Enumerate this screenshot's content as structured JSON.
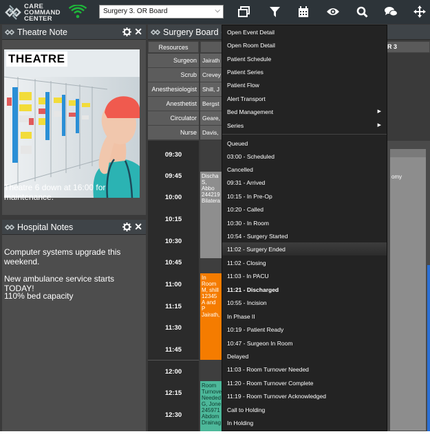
{
  "app": {
    "logo_lines": [
      "CARE",
      "COMMAND",
      "CENTER"
    ],
    "board_select": "Surgery 3. OR Board"
  },
  "toolbar_icons": [
    "window-icon",
    "filter-icon",
    "calendar-icon",
    "eye-icon",
    "search-icon",
    "chat-icon",
    "move-icon"
  ],
  "theatre_panel": {
    "title": "Theatre Note",
    "image_label": "THEATRE",
    "note": "Theatre 6 down at 16:00 for maintenance."
  },
  "hospital_panel": {
    "title": "Hospital Notes",
    "notes": [
      "Computer systems upgrade this weekend.",
      "New ambulance service starts TODAY!",
      "110% bed capacity"
    ]
  },
  "board": {
    "title": "Surgery Board (",
    "resources_header": "Resources",
    "room_fragment": "R 3",
    "roles": [
      {
        "role": "Surgeon",
        "value": "Jairath"
      },
      {
        "role": "Scrub",
        "value": "Crevey"
      },
      {
        "role": "Anesthesiologist",
        "value": "Shill, J"
      },
      {
        "role": "Anesthetist",
        "value": "Bergst"
      },
      {
        "role": "Circulator",
        "value": "Geare,"
      },
      {
        "role": "Nurse",
        "value": "Davis,"
      }
    ],
    "times": [
      "09:30",
      "09:45",
      "10:00",
      "10:15",
      "10:30",
      "10:45",
      "11:00",
      "11:15",
      "11:30",
      "11:45",
      "12:00",
      "12:15",
      "12:30"
    ],
    "blocks": [
      {
        "lines": [
          "Discha",
          "S, Abbo",
          "244219",
          "Bilatera"
        ]
      },
      {
        "lines": [
          "In Room",
          "M, shill",
          "12345",
          "A and P",
          "Jairath,"
        ]
      },
      {
        "lines": [
          "Room",
          "Turnove",
          "Needed",
          "G, Jone",
          "245971",
          "Abdom",
          "Drainag"
        ]
      }
    ],
    "right_card_text": "omy"
  },
  "context_menu": {
    "items": [
      {
        "label": "Open Event Detail"
      },
      {
        "label": "Open Room Detail"
      },
      {
        "label": "Patient Schedule"
      },
      {
        "label": "Patient Series"
      },
      {
        "label": "Patient Flow"
      },
      {
        "label": "Alert Transport"
      },
      {
        "label": "Bed Management",
        "submenu": true
      },
      {
        "label": "Series",
        "submenu": true
      },
      {
        "label": "Queued"
      },
      {
        "label": "03:00 - Scheduled"
      },
      {
        "label": "Cancelled"
      },
      {
        "label": "09:31 - Arrived"
      },
      {
        "label": "10:15 - In Pre-Op"
      },
      {
        "label": "10:20 - Called"
      },
      {
        "label": "10:30 - In Room"
      },
      {
        "label": "10:54 - Surgery Started"
      },
      {
        "label": "11:02 - Surgery Ended"
      },
      {
        "label": "11:02 - Closing"
      },
      {
        "label": "11:03 - In PACU"
      },
      {
        "label": "11:21 - Discharged"
      },
      {
        "label": "10:55 - Incision"
      },
      {
        "label": "In Phase II"
      },
      {
        "label": "10:19 - Patient Ready"
      },
      {
        "label": "10:47 - Surgeon In Room"
      },
      {
        "label": "Delayed"
      },
      {
        "label": "11:03 - Room Turnover Needed"
      },
      {
        "label": "11:20 - Room Turnover Complete"
      },
      {
        "label": "11:19 - Room Turnover Acknowledged"
      },
      {
        "label": "Call to Holding"
      },
      {
        "label": "In Holding"
      }
    ],
    "hovered_item": "11:02 - Surgery Ended",
    "bold_item": "11:21 - Discharged"
  },
  "colors": {
    "topbar": "#2d3439",
    "discharged_block": "#8e8e8e",
    "in_room_block": "#f57c00",
    "turnover_block": "#4db89a",
    "wifi": "#1fb33a",
    "status_stripes": [
      "#e84bb4",
      "#111111",
      "#2ecc40",
      "#b06ad6",
      "#7c2ad4",
      "#8e8e8e",
      "#f57c00",
      "#1a7a3a",
      "#c0c0c0",
      "#2a6fd6",
      "#d4c26a",
      "#8a1a8a",
      "#8a5a2a",
      "#e0e0e0",
      "#c03030",
      "#e07030",
      "#9a9a30",
      "#3ab0a0",
      "#2a8a2a",
      "#6a2ad4",
      "#4a8ad4",
      "#c8e6e6"
    ]
  }
}
